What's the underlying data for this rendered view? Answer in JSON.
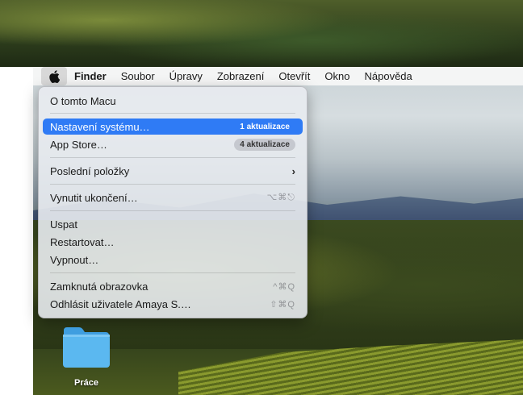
{
  "menubar": {
    "app_name": "Finder",
    "items": [
      "Soubor",
      "Úpravy",
      "Zobrazení",
      "Otevřít",
      "Okno",
      "Nápověda"
    ]
  },
  "apple_menu": {
    "about": "O tomto Macu",
    "system_settings": {
      "label": "Nastavení systému…",
      "badge": "1 aktualizace"
    },
    "app_store": {
      "label": "App Store…",
      "badge": "4 aktualizace"
    },
    "recent_items": "Poslední položky",
    "force_quit": {
      "label": "Vynutit ukončení…",
      "shortcut": "⌥⌘⎋"
    },
    "sleep": "Uspat",
    "restart": "Restartovat…",
    "shutdown": "Vypnout…",
    "lock_screen": {
      "label": "Zamknutá obrazovka",
      "shortcut": "^⌘Q"
    },
    "log_out": {
      "label": "Odhlásit uživatele Amaya S.…",
      "shortcut": "⇧⌘Q"
    }
  },
  "desktop": {
    "folder_label": "Práce"
  },
  "colors": {
    "selection": "#2f7bf5",
    "folder": "#5bb8f0"
  }
}
